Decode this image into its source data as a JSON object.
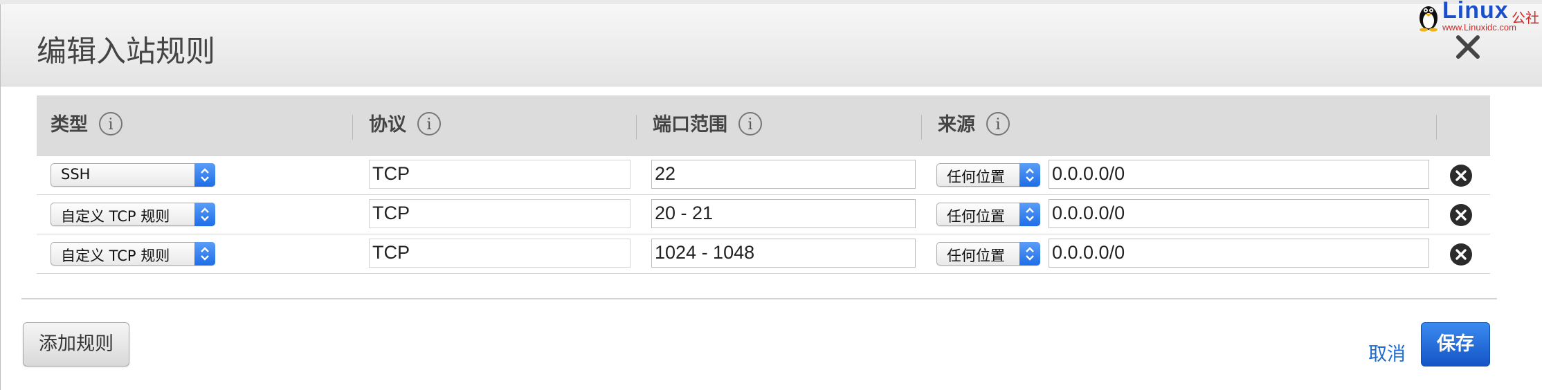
{
  "dialog": {
    "title": "编辑入站规则"
  },
  "watermark": {
    "name": "Linux",
    "suffix": "公社",
    "url": "www.Linuxidc.com"
  },
  "table": {
    "headers": {
      "type": "类型",
      "protocol": "协议",
      "port_range": "端口范围",
      "source": "来源"
    },
    "info_glyph": "i",
    "rows": [
      {
        "type": "SSH",
        "protocol": "TCP",
        "port_range": "22",
        "source_option": "任何位置",
        "source": "0.0.0.0/0"
      },
      {
        "type": "自定义 TCP 规则",
        "protocol": "TCP",
        "port_range": "20 - 21",
        "source_option": "任何位置",
        "source": "0.0.0.0/0"
      },
      {
        "type": "自定义 TCP 规则",
        "protocol": "TCP",
        "port_range": "1024 - 1048",
        "source_option": "任何位置",
        "source": "0.0.0.0/0"
      }
    ]
  },
  "footer": {
    "add_rule": "添加规则",
    "cancel": "取消",
    "save": "保存"
  },
  "icons": {
    "close": "close-icon",
    "info": "info-icon",
    "remove": "remove-circle-icon",
    "select_arrows": "chevron-updown-icon"
  },
  "colors": {
    "accent": "#1f6ee8",
    "link": "#1a6bd2",
    "save_button": "#1554c6",
    "header_bg": "#dcdcdc"
  }
}
